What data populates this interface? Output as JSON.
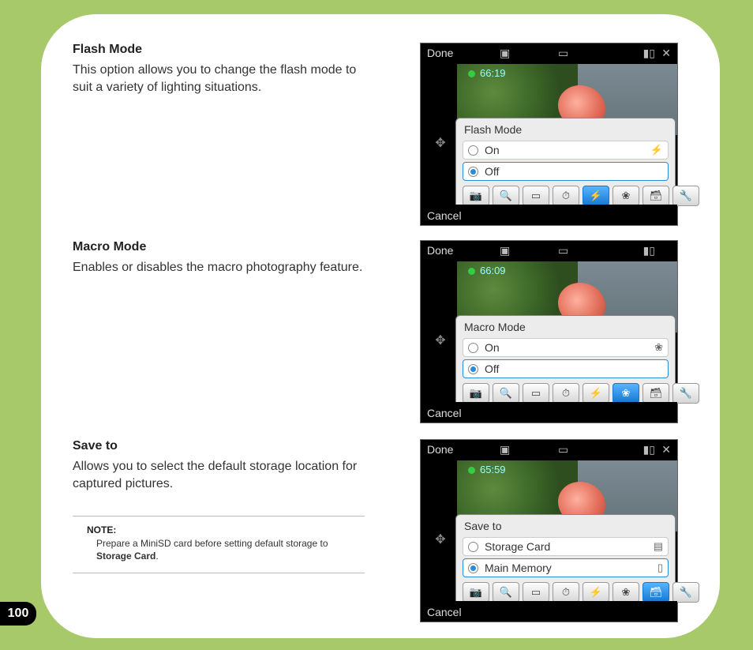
{
  "page_number": "100",
  "sections": [
    {
      "heading": "Flash Mode",
      "body": "This option allows you to change the flash mode to suit a variety of lighting situations."
    },
    {
      "heading": "Macro Mode",
      "body": "Enables or disables the macro photography feature."
    },
    {
      "heading": "Save to",
      "body": "Allows you to select the default storage location for captured pictures."
    }
  ],
  "note": {
    "heading": "NOTE:",
    "prefix": "Prepare a MiniSD card before setting default storage to ",
    "bold": "Storage Card",
    "suffix": "."
  },
  "screenshots": [
    {
      "done": "Done",
      "cancel": "Cancel",
      "timer": "66:19",
      "panel_title": "Flash Mode",
      "options": [
        {
          "label": "On",
          "selected": false,
          "icon": "flash-on-icon",
          "glyph": "⚡"
        },
        {
          "label": "Off",
          "selected": true,
          "icon": "",
          "glyph": ""
        }
      ],
      "toolbar_active": 4,
      "toolbar": [
        {
          "name": "camera-mode-icon",
          "glyph": "📷"
        },
        {
          "name": "zoom-icon",
          "glyph": "🔍"
        },
        {
          "name": "scene-icon",
          "glyph": "▭"
        },
        {
          "name": "timer-icon",
          "glyph": "⏱"
        },
        {
          "name": "flash-icon",
          "glyph": "⚡"
        },
        {
          "name": "macro-icon",
          "glyph": "❀"
        },
        {
          "name": "storage-icon",
          "glyph": "🗃"
        },
        {
          "name": "settings-icon",
          "glyph": "🔧"
        }
      ]
    },
    {
      "done": "Done",
      "cancel": "Cancel",
      "timer": "66:09",
      "panel_title": "Macro Mode",
      "options": [
        {
          "label": "On",
          "selected": false,
          "icon": "macro-on-icon",
          "glyph": "❀"
        },
        {
          "label": "Off",
          "selected": true,
          "icon": "",
          "glyph": ""
        }
      ],
      "toolbar_active": 5,
      "toolbar": [
        {
          "name": "camera-mode-icon",
          "glyph": "📷"
        },
        {
          "name": "zoom-icon",
          "glyph": "🔍"
        },
        {
          "name": "scene-icon",
          "glyph": "▭"
        },
        {
          "name": "timer-icon",
          "glyph": "⏱"
        },
        {
          "name": "flash-icon",
          "glyph": "⚡"
        },
        {
          "name": "macro-icon",
          "glyph": "❀"
        },
        {
          "name": "storage-icon",
          "glyph": "🗃"
        },
        {
          "name": "settings-icon",
          "glyph": "🔧"
        }
      ]
    },
    {
      "done": "Done",
      "cancel": "Cancel",
      "timer": "65:59",
      "panel_title": "Save to",
      "options": [
        {
          "label": "Storage Card",
          "selected": false,
          "icon": "sd-card-icon",
          "glyph": "▤"
        },
        {
          "label": "Main Memory",
          "selected": true,
          "icon": "memory-icon",
          "glyph": "▯"
        }
      ],
      "toolbar_active": 6,
      "toolbar": [
        {
          "name": "camera-mode-icon",
          "glyph": "📷"
        },
        {
          "name": "zoom-icon",
          "glyph": "🔍"
        },
        {
          "name": "scene-icon",
          "glyph": "▭"
        },
        {
          "name": "timer-icon",
          "glyph": "⏱"
        },
        {
          "name": "flash-icon",
          "glyph": "⚡"
        },
        {
          "name": "macro-icon",
          "glyph": "❀"
        },
        {
          "name": "storage-icon",
          "glyph": "🗃"
        },
        {
          "name": "settings-icon",
          "glyph": "🔧"
        }
      ]
    }
  ]
}
